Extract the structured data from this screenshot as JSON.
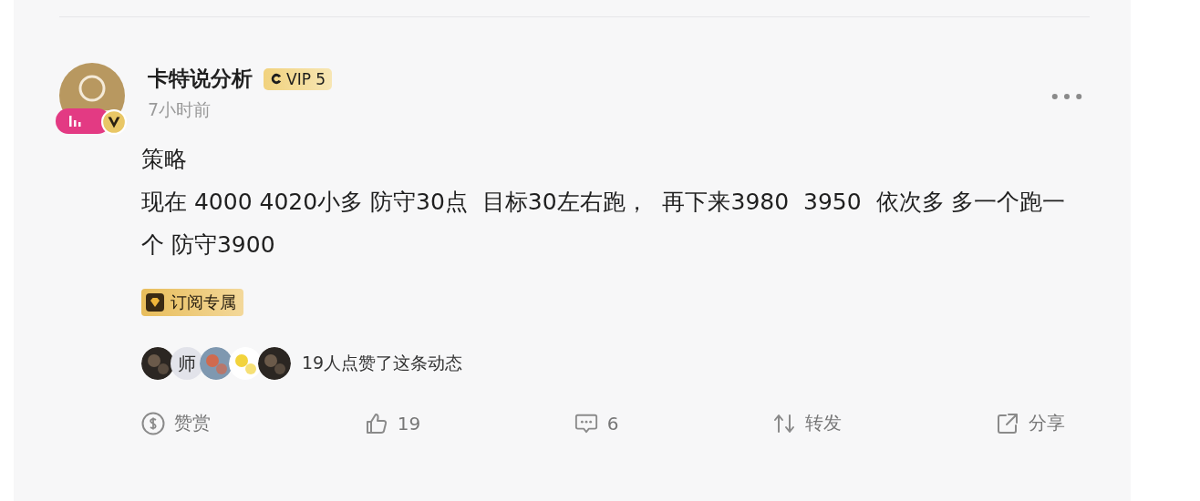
{
  "post": {
    "author": "卡特说分析",
    "vip_badge": "VIP 5",
    "time": "7小时前",
    "lines": [
      "策略",
      "现在 4000 4020小多 防守30点  目标30左右跑，  再下来3980  3950  依次多 多一个跑一个 防守3900"
    ],
    "tag": "订阅专属",
    "likers": [
      {
        "kind": "picture"
      },
      {
        "kind": "text",
        "text": "师"
      },
      {
        "kind": "picture"
      },
      {
        "kind": "picture"
      },
      {
        "kind": "picture"
      }
    ],
    "likes_text": "19人点赞了这条动态",
    "actions": [
      {
        "kind": "reward",
        "label": "赞赏"
      },
      {
        "kind": "like",
        "label": "19"
      },
      {
        "kind": "comment",
        "label": "6"
      },
      {
        "kind": "repost",
        "label": "转发"
      },
      {
        "kind": "share",
        "label": "分享"
      }
    ]
  }
}
